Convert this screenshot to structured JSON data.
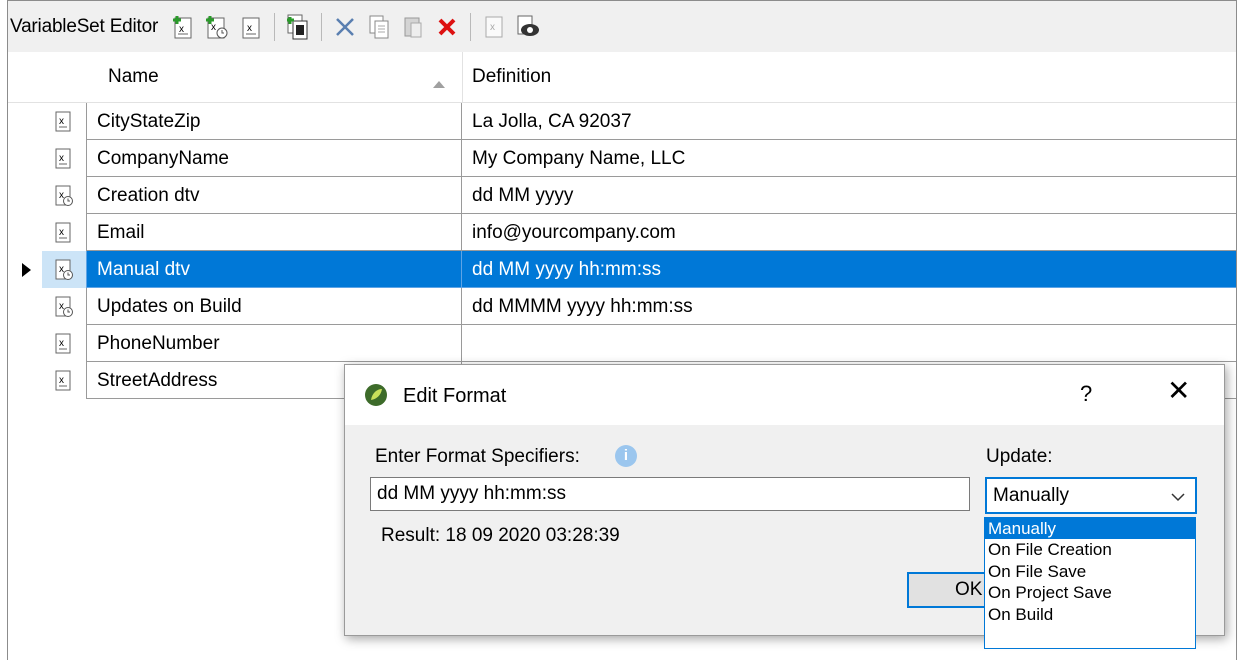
{
  "toolbar": {
    "title": "VariableSet Editor",
    "buttons": [
      "add-variable-icon",
      "add-date-variable-icon",
      "edit-variable-icon",
      "import-variable-icon",
      "cut-icon",
      "copy-icon",
      "paste-icon",
      "delete-icon",
      "blank-variable-icon",
      "preview-icon"
    ]
  },
  "grid": {
    "columns": {
      "name": "Name",
      "definition": "Definition"
    },
    "rows": [
      {
        "name": "CityStateZip",
        "definition": "La Jolla, CA 92037",
        "icon": "variable-icon"
      },
      {
        "name": "CompanyName",
        "definition": "My Company Name, LLC",
        "icon": "variable-icon"
      },
      {
        "name": "Creation dtv",
        "definition": "dd MM yyyy",
        "icon": "datetime-variable-icon"
      },
      {
        "name": "Email",
        "definition": "info@yourcompany.com",
        "icon": "variable-icon"
      },
      {
        "name": "Manual dtv",
        "definition": "dd MM yyyy hh:mm:ss",
        "icon": "datetime-variable-icon",
        "selected": true
      },
      {
        "name": "Updates on Build",
        "definition": "dd MMMM yyyy hh:mm:ss",
        "icon": "datetime-variable-icon"
      },
      {
        "name": "PhoneNumber",
        "definition": "",
        "icon": "variable-icon"
      },
      {
        "name": "StreetAddress",
        "definition": "",
        "icon": "variable-icon"
      }
    ]
  },
  "dialog": {
    "title": "Edit Format",
    "help": "?",
    "close": "✕",
    "spec_label": "Enter Format Specifiers:",
    "spec_value": "dd MM yyyy hh:mm:ss",
    "result": "Result: 18 09 2020 03:28:39",
    "update_label": "Update:",
    "update_value": "Manually",
    "ok_label": "OK",
    "update_options": [
      "Manually",
      "On File Creation",
      "On File Save",
      "On Project Save",
      "On Build"
    ],
    "accent": "#0078d7"
  }
}
